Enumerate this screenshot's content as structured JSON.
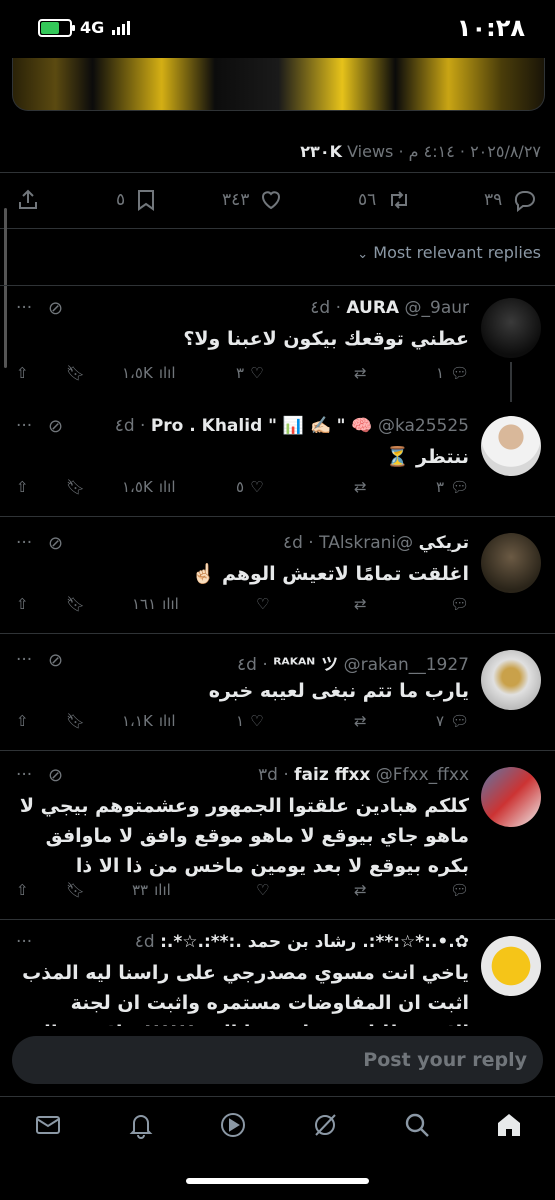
{
  "status_bar": {
    "time": "١٠:٢٨",
    "network": "4G"
  },
  "tweet": {
    "meta_date": "٢٠٢٥/٨/٢٧ · ٤:١٤ م · ",
    "meta_views_count": "٢٣٠K",
    "meta_views_label": " Views",
    "bookmarks": "٥",
    "likes": "٣٤٣",
    "retweets": "٥٦",
    "replies": "٣٩"
  },
  "sort_label": "Most relevant replies",
  "replies": [
    {
      "name": "AURA",
      "handle": "@_9aur",
      "time": "٤d",
      "text": "عطني توقعك بيكون لاعبنا ولا؟",
      "views": "١،٥K",
      "likes": "٣",
      "retweets": "",
      "replies": "١"
    },
    {
      "name": "Pro . Khalid \" 📊 ✍🏻",
      "name_prefix": "\" 🧠",
      "handle": "@ka25525",
      "time": "٤d",
      "text": "ننتظر ⏳",
      "views": "١،٥K",
      "likes": "٥",
      "retweets": "",
      "replies": "٣"
    },
    {
      "name": "تريكي",
      "handle": "@TAlskrani",
      "time": "٤d",
      "text": "اغلقت تمامًا لاتعيش الوهم ☝🏻",
      "views": "١٦١",
      "likes": "",
      "retweets": "",
      "replies": ""
    },
    {
      "name": "ᴿᴬᴷᴬᴺ ツ",
      "handle": "@rakan__1927",
      "time": "٤d",
      "text": "يارب ما تتم نبغى لعيبه خبره",
      "views": "١،١K",
      "likes": "١",
      "retweets": "",
      "replies": "٧"
    },
    {
      "name": "faiz ffxx",
      "handle": "@Ffxx_ffxx",
      "time": "٣d",
      "text": "كلكم هبادين علقتوا الجمهور وعشمتوهم بيجي لا ماهو جاي بيوقع لا ماهو موقع وافق لا ماوافق بكره بيوقع لا بعد يومين ماخس من ذا الا ذا",
      "views": "٣٣",
      "likes": "",
      "retweets": "",
      "replies": ""
    },
    {
      "name": "✿.•.:*☆:**:. رشاد بن حمد .:**:.☆*.:",
      "handle": "…",
      "time": "٤d",
      "text": "ياخي انت مسوي مصدرجي على راسنا ليه المذب اثبت ان المفاوضات مستمره واثبت ان لجنة الاستقطابات ننتظر منها الرد !!!!!! خلاص تراك",
      "views": "",
      "likes": "",
      "retweets": "",
      "replies": ""
    }
  ],
  "compose_placeholder": "Post your reply",
  "tabs": [
    "home-icon",
    "search-icon",
    "grok-icon",
    "video-icon",
    "notifications-icon",
    "messages-icon"
  ],
  "colors": {
    "background": "#000000",
    "text": "#e7e9ea",
    "muted": "#71767b",
    "separator": "#2f3336"
  }
}
